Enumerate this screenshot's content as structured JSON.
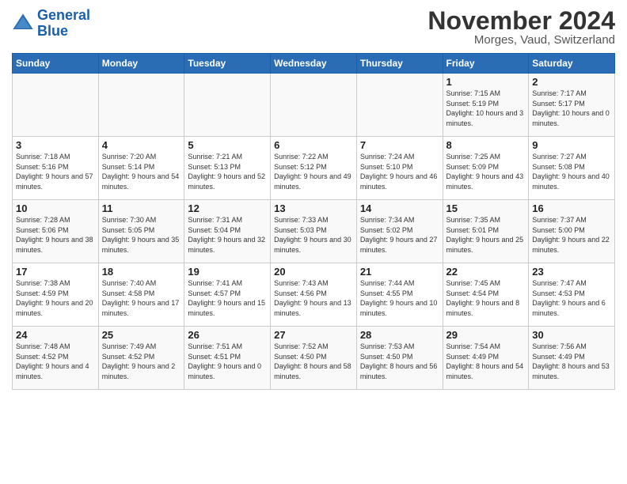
{
  "logo": {
    "line1": "General",
    "line2": "Blue"
  },
  "title": "November 2024",
  "location": "Morges, Vaud, Switzerland",
  "weekdays": [
    "Sunday",
    "Monday",
    "Tuesday",
    "Wednesday",
    "Thursday",
    "Friday",
    "Saturday"
  ],
  "weeks": [
    [
      {
        "day": "",
        "info": ""
      },
      {
        "day": "",
        "info": ""
      },
      {
        "day": "",
        "info": ""
      },
      {
        "day": "",
        "info": ""
      },
      {
        "day": "",
        "info": ""
      },
      {
        "day": "1",
        "info": "Sunrise: 7:15 AM\nSunset: 5:19 PM\nDaylight: 10 hours\nand 3 minutes."
      },
      {
        "day": "2",
        "info": "Sunrise: 7:17 AM\nSunset: 5:17 PM\nDaylight: 10 hours\nand 0 minutes."
      }
    ],
    [
      {
        "day": "3",
        "info": "Sunrise: 7:18 AM\nSunset: 5:16 PM\nDaylight: 9 hours\nand 57 minutes."
      },
      {
        "day": "4",
        "info": "Sunrise: 7:20 AM\nSunset: 5:14 PM\nDaylight: 9 hours\nand 54 minutes."
      },
      {
        "day": "5",
        "info": "Sunrise: 7:21 AM\nSunset: 5:13 PM\nDaylight: 9 hours\nand 52 minutes."
      },
      {
        "day": "6",
        "info": "Sunrise: 7:22 AM\nSunset: 5:12 PM\nDaylight: 9 hours\nand 49 minutes."
      },
      {
        "day": "7",
        "info": "Sunrise: 7:24 AM\nSunset: 5:10 PM\nDaylight: 9 hours\nand 46 minutes."
      },
      {
        "day": "8",
        "info": "Sunrise: 7:25 AM\nSunset: 5:09 PM\nDaylight: 9 hours\nand 43 minutes."
      },
      {
        "day": "9",
        "info": "Sunrise: 7:27 AM\nSunset: 5:08 PM\nDaylight: 9 hours\nand 40 minutes."
      }
    ],
    [
      {
        "day": "10",
        "info": "Sunrise: 7:28 AM\nSunset: 5:06 PM\nDaylight: 9 hours\nand 38 minutes."
      },
      {
        "day": "11",
        "info": "Sunrise: 7:30 AM\nSunset: 5:05 PM\nDaylight: 9 hours\nand 35 minutes."
      },
      {
        "day": "12",
        "info": "Sunrise: 7:31 AM\nSunset: 5:04 PM\nDaylight: 9 hours\nand 32 minutes."
      },
      {
        "day": "13",
        "info": "Sunrise: 7:33 AM\nSunset: 5:03 PM\nDaylight: 9 hours\nand 30 minutes."
      },
      {
        "day": "14",
        "info": "Sunrise: 7:34 AM\nSunset: 5:02 PM\nDaylight: 9 hours\nand 27 minutes."
      },
      {
        "day": "15",
        "info": "Sunrise: 7:35 AM\nSunset: 5:01 PM\nDaylight: 9 hours\nand 25 minutes."
      },
      {
        "day": "16",
        "info": "Sunrise: 7:37 AM\nSunset: 5:00 PM\nDaylight: 9 hours\nand 22 minutes."
      }
    ],
    [
      {
        "day": "17",
        "info": "Sunrise: 7:38 AM\nSunset: 4:59 PM\nDaylight: 9 hours\nand 20 minutes."
      },
      {
        "day": "18",
        "info": "Sunrise: 7:40 AM\nSunset: 4:58 PM\nDaylight: 9 hours\nand 17 minutes."
      },
      {
        "day": "19",
        "info": "Sunrise: 7:41 AM\nSunset: 4:57 PM\nDaylight: 9 hours\nand 15 minutes."
      },
      {
        "day": "20",
        "info": "Sunrise: 7:43 AM\nSunset: 4:56 PM\nDaylight: 9 hours\nand 13 minutes."
      },
      {
        "day": "21",
        "info": "Sunrise: 7:44 AM\nSunset: 4:55 PM\nDaylight: 9 hours\nand 10 minutes."
      },
      {
        "day": "22",
        "info": "Sunrise: 7:45 AM\nSunset: 4:54 PM\nDaylight: 9 hours\nand 8 minutes."
      },
      {
        "day": "23",
        "info": "Sunrise: 7:47 AM\nSunset: 4:53 PM\nDaylight: 9 hours\nand 6 minutes."
      }
    ],
    [
      {
        "day": "24",
        "info": "Sunrise: 7:48 AM\nSunset: 4:52 PM\nDaylight: 9 hours\nand 4 minutes."
      },
      {
        "day": "25",
        "info": "Sunrise: 7:49 AM\nSunset: 4:52 PM\nDaylight: 9 hours\nand 2 minutes."
      },
      {
        "day": "26",
        "info": "Sunrise: 7:51 AM\nSunset: 4:51 PM\nDaylight: 9 hours\nand 0 minutes."
      },
      {
        "day": "27",
        "info": "Sunrise: 7:52 AM\nSunset: 4:50 PM\nDaylight: 8 hours\nand 58 minutes."
      },
      {
        "day": "28",
        "info": "Sunrise: 7:53 AM\nSunset: 4:50 PM\nDaylight: 8 hours\nand 56 minutes."
      },
      {
        "day": "29",
        "info": "Sunrise: 7:54 AM\nSunset: 4:49 PM\nDaylight: 8 hours\nand 54 minutes."
      },
      {
        "day": "30",
        "info": "Sunrise: 7:56 AM\nSunset: 4:49 PM\nDaylight: 8 hours\nand 53 minutes."
      }
    ]
  ]
}
